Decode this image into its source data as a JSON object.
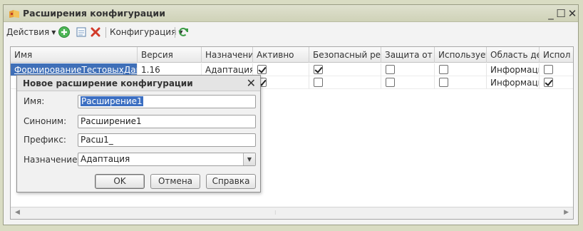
{
  "window": {
    "title": "Расширения конфигурации",
    "minimize": "_",
    "maximize": "☐",
    "close": "✕"
  },
  "toolbar": {
    "actions_label": "Действия",
    "config_label": "Конфигурация",
    "icons": [
      "add-icon",
      "copy-icon",
      "delete-icon",
      "refresh-icon"
    ]
  },
  "grid": {
    "columns": [
      "Имя",
      "Версия",
      "Назначение",
      "Активно",
      "Безопасный реж...",
      "Защита от ...",
      "Используетс...",
      "Область де...",
      "Испол"
    ],
    "rows": [
      {
        "name": "ФормированиеТестовыхДанн...",
        "version": "1.16",
        "purpose": "Адаптация",
        "active": true,
        "safe": true,
        "protect": false,
        "uses": false,
        "area": "Информаци...",
        "use2": false
      },
      {
        "name": "",
        "version": "",
        "purpose": "",
        "active": true,
        "safe": false,
        "protect": false,
        "uses": false,
        "area": "Информаци...",
        "use2": true
      }
    ]
  },
  "dialog": {
    "title": "Новое расширение конфигурации",
    "close": "✕",
    "fields": {
      "name_label": "Имя:",
      "name_value": "Расширение1",
      "synonym_label": "Синоним:",
      "synonym_value": "Расширение1",
      "prefix_label": "Префикс:",
      "prefix_value": "Расш1_",
      "purpose_label": "Назначение:",
      "purpose_value": "Адаптация"
    },
    "buttons": {
      "ok": "OK",
      "cancel": "Отмена",
      "help": "Справка"
    }
  },
  "colors": {
    "background": "#d9dcc3",
    "selection": "#3f6fb8",
    "link": "#1a4fb0",
    "add_icon": "#3aa84a",
    "delete_icon": "#d23a2a"
  }
}
